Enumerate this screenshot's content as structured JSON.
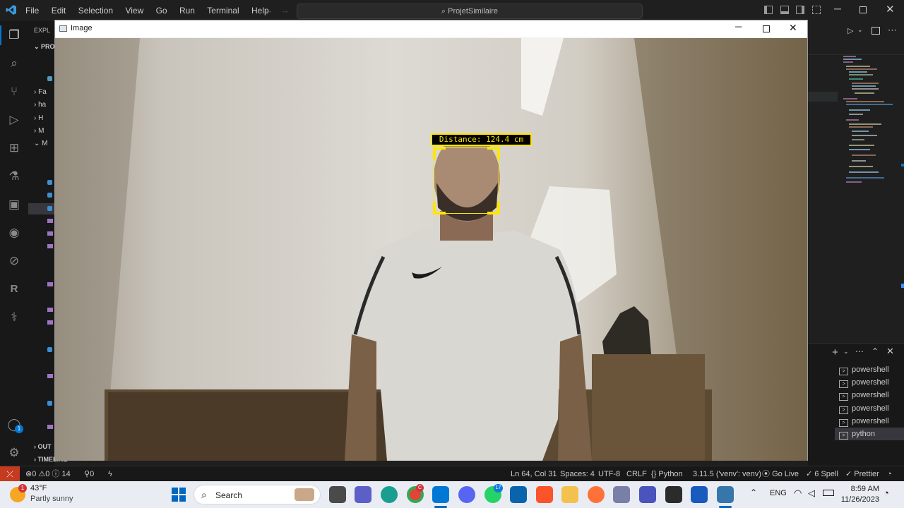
{
  "vscode": {
    "menu": [
      "File",
      "Edit",
      "Selection",
      "View",
      "Go",
      "Run",
      "Terminal",
      "Help"
    ],
    "command_center": "ProjetSimilaire",
    "explorer_header": "EXPL",
    "explorer_root": "PRO",
    "tree": [
      "Fa",
      "ha",
      "H",
      "M",
      "M"
    ],
    "outline_label": "OUT",
    "timeline_label": "TIMELINE",
    "accounts_badge": "1",
    "terminals": [
      "powershell",
      "powershell",
      "powershell",
      "powershell",
      "powershell",
      "python"
    ]
  },
  "image_window": {
    "title": "Image",
    "overlay_label": "Distance: 124.4 cm"
  },
  "status_bar": {
    "errors": "0",
    "warnings": "0",
    "infos": "14",
    "ports": "0",
    "cursor": "Ln 64, Col 31",
    "spaces": "Spaces: 4",
    "encoding": "UTF-8",
    "eol": "CRLF",
    "language": "Python",
    "interpreter": "3.11.5 ('venv': venv)",
    "go_live": "Go Live",
    "spell": "6 Spell",
    "prettier": "Prettier"
  },
  "taskbar": {
    "weather_temp": "43°F",
    "weather_desc": "Partly sunny",
    "weather_badge": "1",
    "search_label": "Search",
    "chrome_badge": "C",
    "whatsapp_badge": "17",
    "language": "ENG",
    "time": "8:59 AM",
    "date": "11/26/2023"
  },
  "colors": {
    "overlay_box": "#ffe600",
    "status_remote": "#c53b20",
    "vscode_accent": "#0078d4"
  }
}
